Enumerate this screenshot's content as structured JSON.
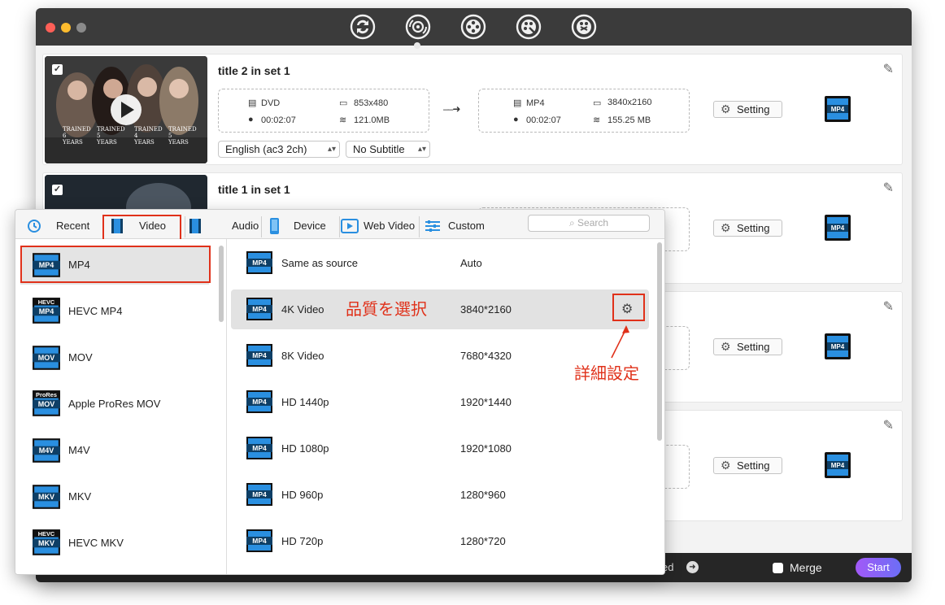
{
  "window": {
    "nav_icons": [
      "convert-icon",
      "rip-icon",
      "video-reel-icon",
      "video-edit-icon",
      "video-tool-icon"
    ]
  },
  "rows": [
    {
      "title": "title 2 in set 1",
      "source": {
        "format": "DVD",
        "duration": "00:02:07",
        "resolution": "853x480",
        "size": "121.0MB"
      },
      "target": {
        "format": "MP4",
        "duration": "00:02:07",
        "resolution": "3840x2160",
        "size": "155.25 MB"
      },
      "audio_select": "English (ac3 2ch)",
      "subtitle_select": "No Subtitle",
      "setting_label": "Setting",
      "thumb_captions": [
        "TRAINED 6 YEARS",
        "TRAINED 5 YEARS",
        "TRAINED 4 YEARS",
        "TRAINED 5 YEARS"
      ],
      "checked": true
    },
    {
      "title": "title 1 in set 1",
      "setting_label": "Setting",
      "checked": true
    },
    {
      "setting_label": "Setting"
    },
    {
      "setting_label": "Setting"
    }
  ],
  "bottom_bar": {
    "path_suffix": "ed",
    "merge_label": "Merge",
    "start_label": "Start"
  },
  "popup": {
    "tabs": [
      {
        "label": "Recent",
        "icon": "recent-icon"
      },
      {
        "label": "Video",
        "icon": "film-icon"
      },
      {
        "label": "Audio",
        "icon": "audio-film-icon"
      },
      {
        "label": "Device",
        "icon": "phone-icon"
      },
      {
        "label": "Web Video",
        "icon": "web-video-icon"
      },
      {
        "label": "Custom",
        "icon": "sliders-icon"
      }
    ],
    "search_placeholder": "Search",
    "formats": [
      {
        "label": "MP4",
        "badge": "MP4",
        "top": ""
      },
      {
        "label": "HEVC MP4",
        "badge": "MP4",
        "top": "HEVC"
      },
      {
        "label": "MOV",
        "badge": "MOV",
        "top": ""
      },
      {
        "label": "Apple ProRes MOV",
        "badge": "MOV",
        "top": "ProRes"
      },
      {
        "label": "M4V",
        "badge": "M4V",
        "top": ""
      },
      {
        "label": "MKV",
        "badge": "MKV",
        "top": ""
      },
      {
        "label": "HEVC MKV",
        "badge": "MKV",
        "top": "HEVC"
      }
    ],
    "qualities": [
      {
        "name": "Same as source",
        "res": "Auto"
      },
      {
        "name": "4K Video",
        "res": "3840*2160"
      },
      {
        "name": "8K Video",
        "res": "7680*4320"
      },
      {
        "name": "HD 1440p",
        "res": "1920*1440"
      },
      {
        "name": "HD 1080p",
        "res": "1920*1080"
      },
      {
        "name": "HD 960p",
        "res": "1280*960"
      },
      {
        "name": "HD 720p",
        "res": "1280*720"
      }
    ]
  },
  "annotations": {
    "quality": "品質を選択",
    "details": "詳細設定"
  },
  "colors": {
    "highlight": "#e0311a",
    "badge_blue": "#2a8fe0",
    "start_gradient": [
      "#a259f7",
      "#6c6ef6"
    ]
  }
}
